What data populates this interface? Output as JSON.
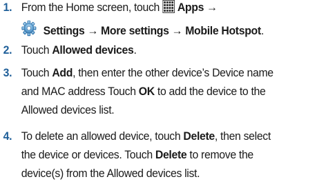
{
  "steps": [
    {
      "number": "1.",
      "line1_prefix": "From the Home screen, touch",
      "apps_label": "Apps →",
      "line2": "Settings → More settings → Mobile Hotspot",
      "line2_end": ".",
      "icons": [
        "apps-grid-icon",
        "settings-gear-icon"
      ]
    },
    {
      "number": "2.",
      "prefix": "Touch",
      "bold": "Allowed devices",
      "suffix": "."
    },
    {
      "number": "3.",
      "prefix": "Touch",
      "bold1": "Add",
      "line1_rest": ", then enter the other device’s Device name",
      "line2_prefix": "and MAC address Touch",
      "bold2": "OK",
      "line2_rest": "to add the device to the",
      "line3": "Allowed devices list."
    },
    {
      "number": "4.",
      "line1_prefix": "To delete an allowed device, touch",
      "bold1": "Delete",
      "line1_rest": ", then select",
      "line2_prefix": "the device or devices. Touch",
      "bold2": "Delete",
      "line2_rest": "to remove the",
      "line3": "device(s) from the Allowed devices list."
    }
  ],
  "colors": {
    "number": "#1f5f99",
    "text": "#1a1a1a",
    "gear": "#4a90c8"
  }
}
